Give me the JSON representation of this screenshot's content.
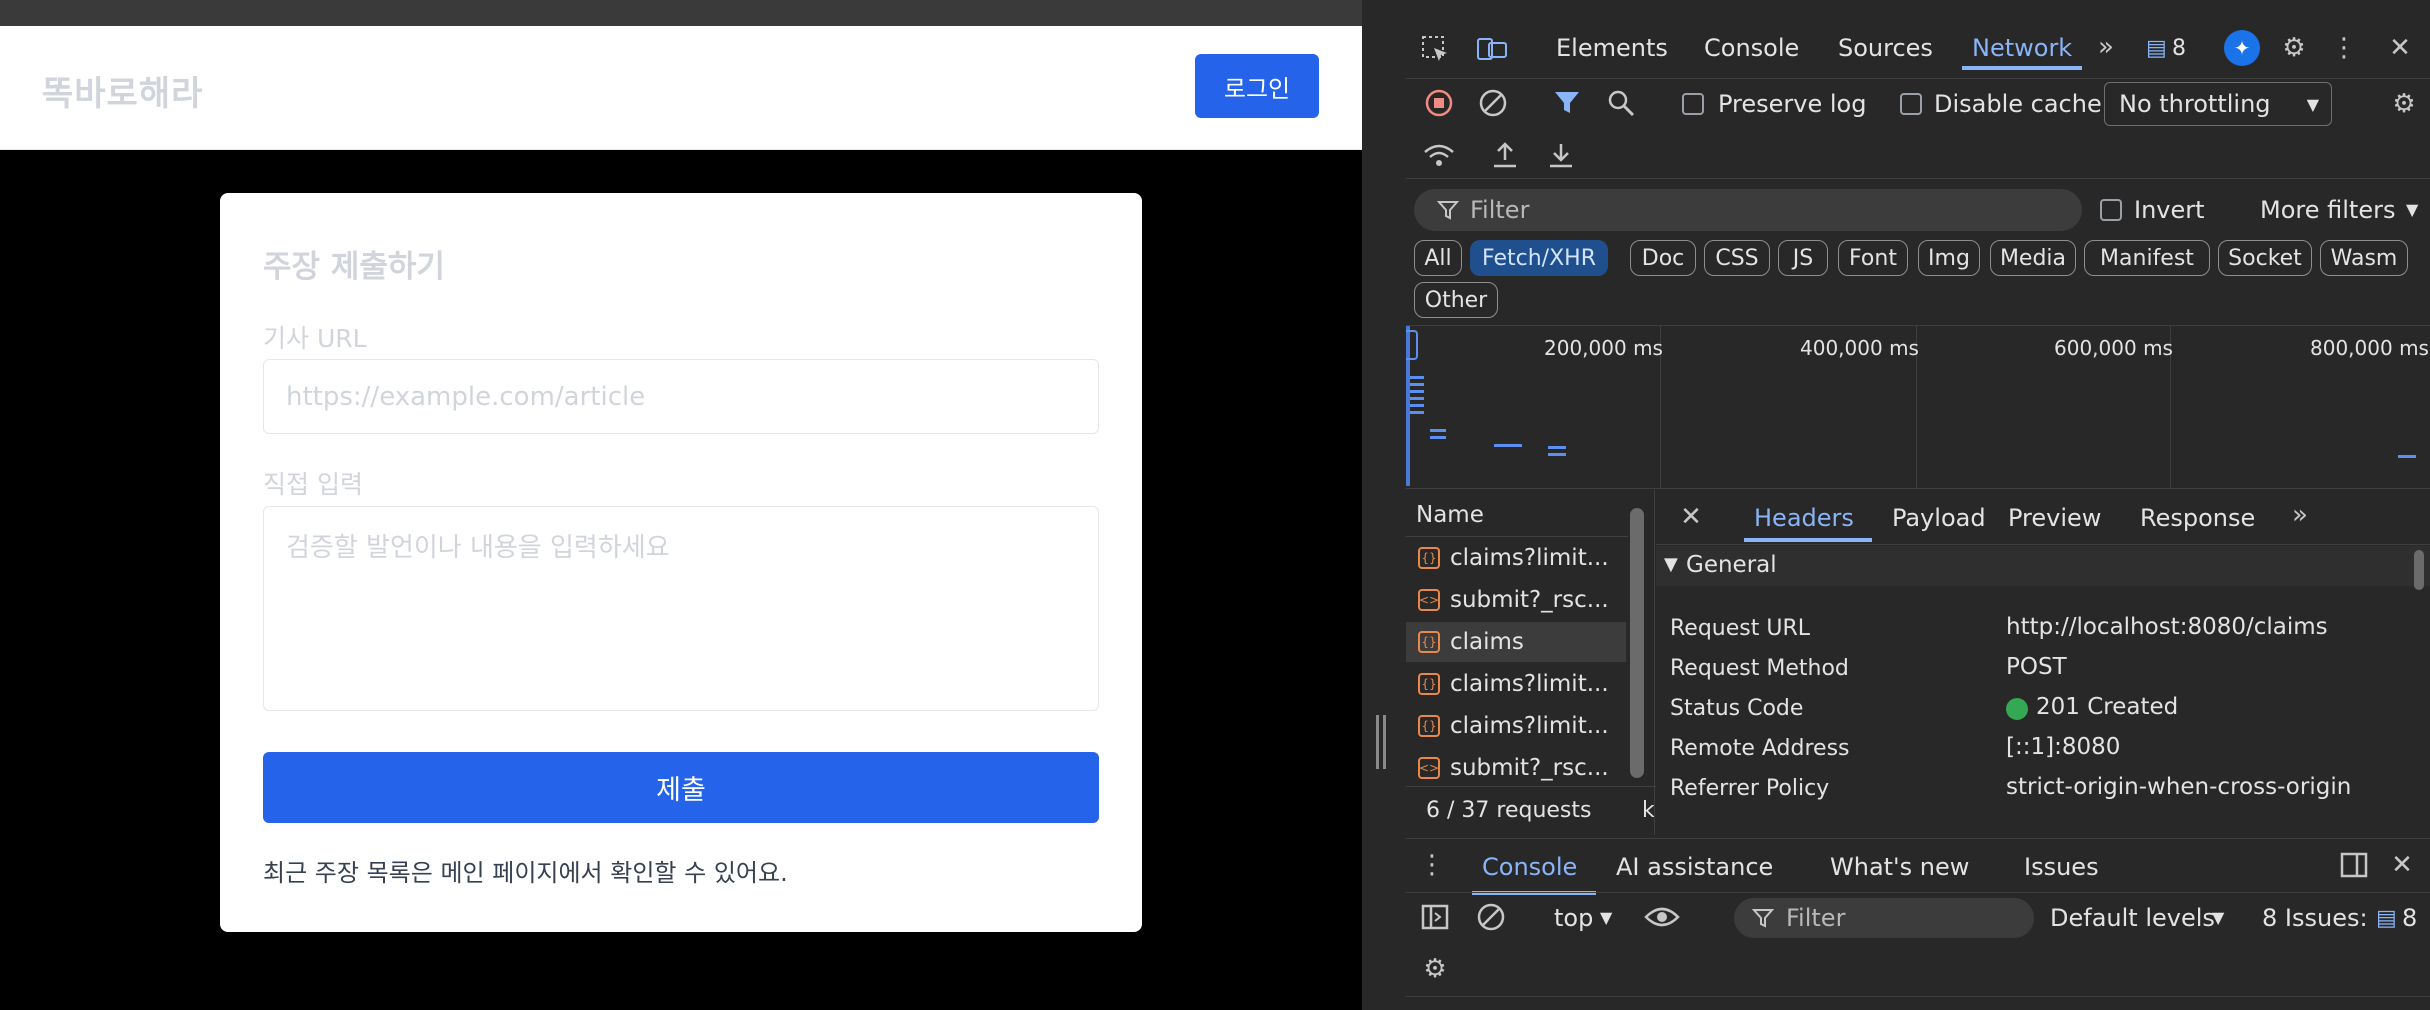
{
  "page": {
    "logo": "똑바로해라",
    "login_label": "로그인",
    "card_title": "주장 제출하기",
    "url_label": "기사 URL",
    "url_placeholder": "https://example.com/article",
    "text_label": "직접 입력",
    "text_placeholder": "검증할 발언이나 내용을 입력하세요",
    "submit_label": "제출",
    "note": "최근 주장 목록은 메인 페이지에서 확인할 수 있어요."
  },
  "devtools": {
    "tabs": [
      "Elements",
      "Console",
      "Sources",
      "Network"
    ],
    "active_tab": "Network",
    "issues_badge": "8",
    "toolbar": {
      "preserve_log": "Preserve log",
      "disable_cache": "Disable cache",
      "throttling": "No throttling"
    },
    "filter_placeholder": "Filter",
    "invert": "Invert",
    "more_filters": "More filters",
    "type_filters": [
      "All",
      "Fetch/XHR",
      "Doc",
      "CSS",
      "JS",
      "Font",
      "Img",
      "Media",
      "Manifest",
      "Socket",
      "Wasm",
      "Other"
    ],
    "active_type": "Fetch/XHR",
    "timeline_labels": [
      "200,000 ms",
      "400,000 ms",
      "600,000 ms",
      "800,000 ms"
    ],
    "name_header": "Name",
    "requests": [
      {
        "name": "claims?limit...",
        "type": "fetch"
      },
      {
        "name": "submit?_rsc...",
        "type": "doc"
      },
      {
        "name": "claims",
        "type": "fetch"
      },
      {
        "name": "claims?limit...",
        "type": "fetch"
      },
      {
        "name": "claims?limit...",
        "type": "fetch"
      },
      {
        "name": "submit?_rsc...",
        "type": "doc"
      }
    ],
    "selected_request": 2,
    "summary": "6 / 37 requests",
    "summary_tail": "k",
    "detail_tabs": [
      "Headers",
      "Payload",
      "Preview",
      "Response"
    ],
    "active_detail_tab": "Headers",
    "general_title": "General",
    "general": [
      {
        "key": "Request URL",
        "value": "http://localhost:8080/claims"
      },
      {
        "key": "Request Method",
        "value": "POST"
      },
      {
        "key": "Status Code",
        "value": "201 Created"
      },
      {
        "key": "Remote Address",
        "value": "[::1]:8080"
      },
      {
        "key": "Referrer Policy",
        "value": "strict-origin-when-cross-origin"
      }
    ],
    "drawer_tabs": [
      "Console",
      "AI assistance",
      "What's new",
      "Issues"
    ],
    "active_drawer_tab": "Console",
    "console_context": "top",
    "console_filter": "Filter",
    "levels": "Default levels",
    "issues_count": "8 Issues:",
    "issues_count_badge": "8",
    "colors": {
      "accent": "#8ab4f8",
      "brand_blue": "#2563eb",
      "status_ok": "#34a853"
    }
  }
}
